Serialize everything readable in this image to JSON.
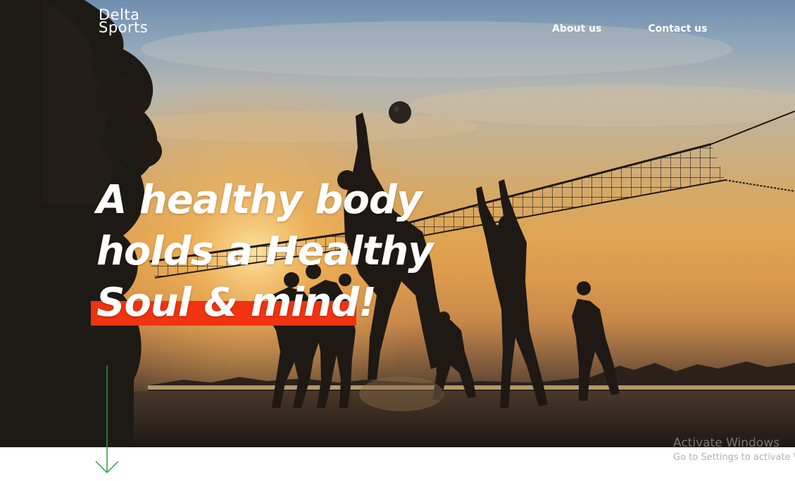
{
  "brand": {
    "logo_line1": "Delta",
    "logo_line2": "Sports"
  },
  "nav": {
    "items": [
      {
        "label": "About us"
      },
      {
        "label": "Contact us"
      }
    ]
  },
  "hero": {
    "headline_line1": "A healthy body",
    "headline_line2": "holds a Healthy",
    "headline_line3": "Soul & mind!",
    "highlight_color": "#f03310",
    "scroll_indicator_icon": "arrow-down-icon",
    "scroll_indicator_color": "#2e9b3e"
  },
  "watermark": {
    "title": "Activate Windows",
    "subtitle": "Go to Settings to activate W"
  }
}
